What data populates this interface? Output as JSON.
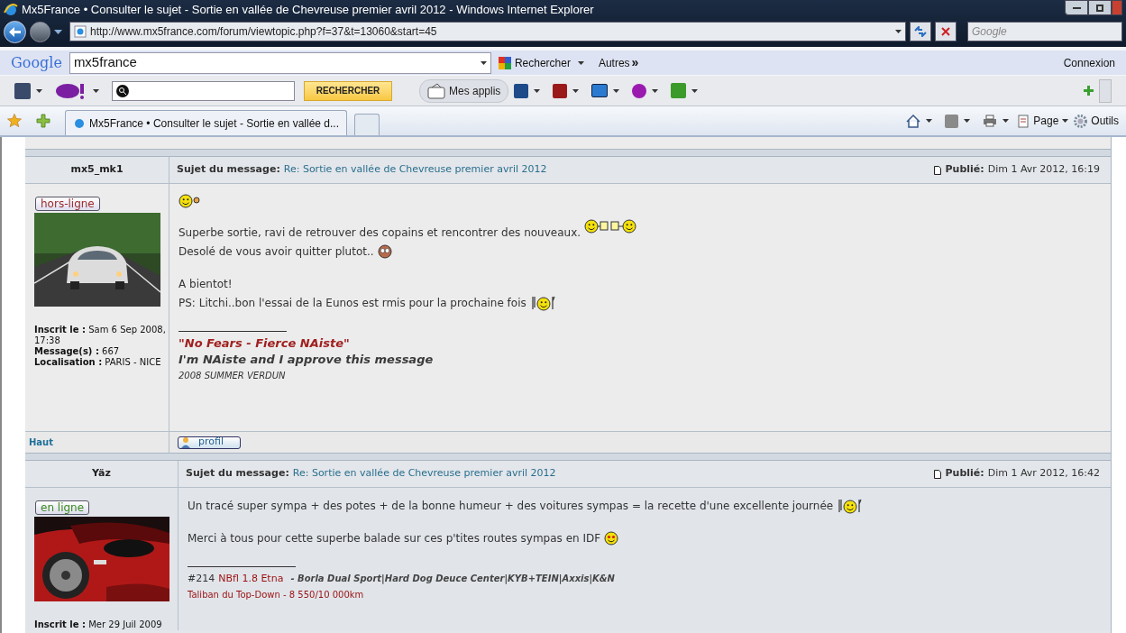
{
  "window": {
    "title": "Mx5France • Consulter le sujet - Sortie en vallée de Chevreuse premier avril 2012 - Windows Internet Explorer"
  },
  "address_bar": {
    "url": "http://www.mx5france.com/forum/viewtopic.php?f=37&t=13060&start=45"
  },
  "web_search": {
    "placeholder": "Google"
  },
  "google_toolbar": {
    "logo": "Google",
    "query": "mx5france",
    "search_button": "Rechercher",
    "more_button": "Autres",
    "more_glyph": "»",
    "sign_in": "Connexion"
  },
  "yahoo_toolbar": {
    "search_button": "RECHERCHER",
    "apps_button": "Mes applis"
  },
  "tabs": [
    {
      "label": "Mx5France • Consulter le sujet - Sortie en vallée d...",
      "selected": true
    }
  ],
  "command_bar": {
    "page_button": "Page",
    "tools_button": "Outils"
  },
  "posts": [
    {
      "author": "mx5_mk1",
      "status": {
        "label": "hors-ligne",
        "online": false
      },
      "avatar": {
        "kind": "picture"
      },
      "profile": [
        {
          "label": "Inscrit le :",
          "value": "Sam 6 Sep 2008, 17:38"
        },
        {
          "label": "Message(s) :",
          "value": "667"
        },
        {
          "label": "Localisation :",
          "value": "PARIS - NICE"
        }
      ],
      "subject_label": "Sujet du message:",
      "subject": "Re: Sortie en vallée de Chevreuse premier avril 2012",
      "published_label": "Publié:",
      "date": "Dim 1 Avr 2012, 16:19",
      "paragraphs": [
        [
          {
            "emoticon": {
              "kind": "wave"
            }
          }
        ],
        [
          {
            "text": "Superbe sortie, ravi de retrouver des copains et rencontrer des nouveaux.",
            "emoticon": {
              "kind": "cheers"
            }
          },
          {
            "text": "Desolé de vous avoir quitter plutot..",
            "emoticon": {
              "kind": "eyes"
            }
          }
        ],
        [
          {
            "text": "A bientot!"
          },
          {
            "text": "PS: Litchi..bon l'essai de la Eunos est rmis pour la prochaine fois",
            "emoticon": {
              "kind": "eat"
            }
          }
        ]
      ],
      "signature": [
        [
          {
            "text": "\"No Fears - Fierce NAiste\"",
            "kind": "quote"
          }
        ],
        [
          {
            "text": "I'm NAiste and I approve this message",
            "kind": "motto"
          }
        ],
        [
          {
            "text": "2008 SUMMER VERDUN",
            "kind": "small"
          }
        ]
      ],
      "footer": {
        "top_link": "Haut",
        "profile_button": "profil"
      }
    },
    {
      "author": "Yäz",
      "status": {
        "label": "en ligne",
        "online": true
      },
      "avatar": {
        "kind": "picture"
      },
      "profile": [
        {
          "label": "Inscrit le :",
          "value": "Mer 29 Juil 2009"
        }
      ],
      "subject_label": "Sujet du message:",
      "subject": "Re: Sortie en vallée de Chevreuse premier avril 2012",
      "published_label": "Publié:",
      "date": "Dim 1 Avr 2012, 16:42",
      "paragraphs": [
        [
          {
            "text": "Un tracé super sympa + des potes + de la bonne humeur + des voitures sympas = la recette d'une excellente journée",
            "emoticon": {
              "kind": "eat"
            }
          }
        ],
        [
          {
            "text": "Merci à tous pour cette superbe balade sur ces p'tites routes sympas en IDF",
            "emoticon": {
              "kind": "love"
            }
          }
        ]
      ],
      "signature": [
        [
          {
            "text": "#214",
            "kind": "number"
          },
          {
            "text": "NBfl 1.8 Etna",
            "kind": "model"
          },
          {
            "text": "- Borla Dual Sport|Hard Dog Deuce Center|KYB+TEIN|Axxis|K&N",
            "kind": "gear"
          }
        ],
        [
          {
            "text": "Taliban du Top-Down - 8 550/10 000km",
            "kind": "tagline"
          }
        ]
      ]
    }
  ]
}
